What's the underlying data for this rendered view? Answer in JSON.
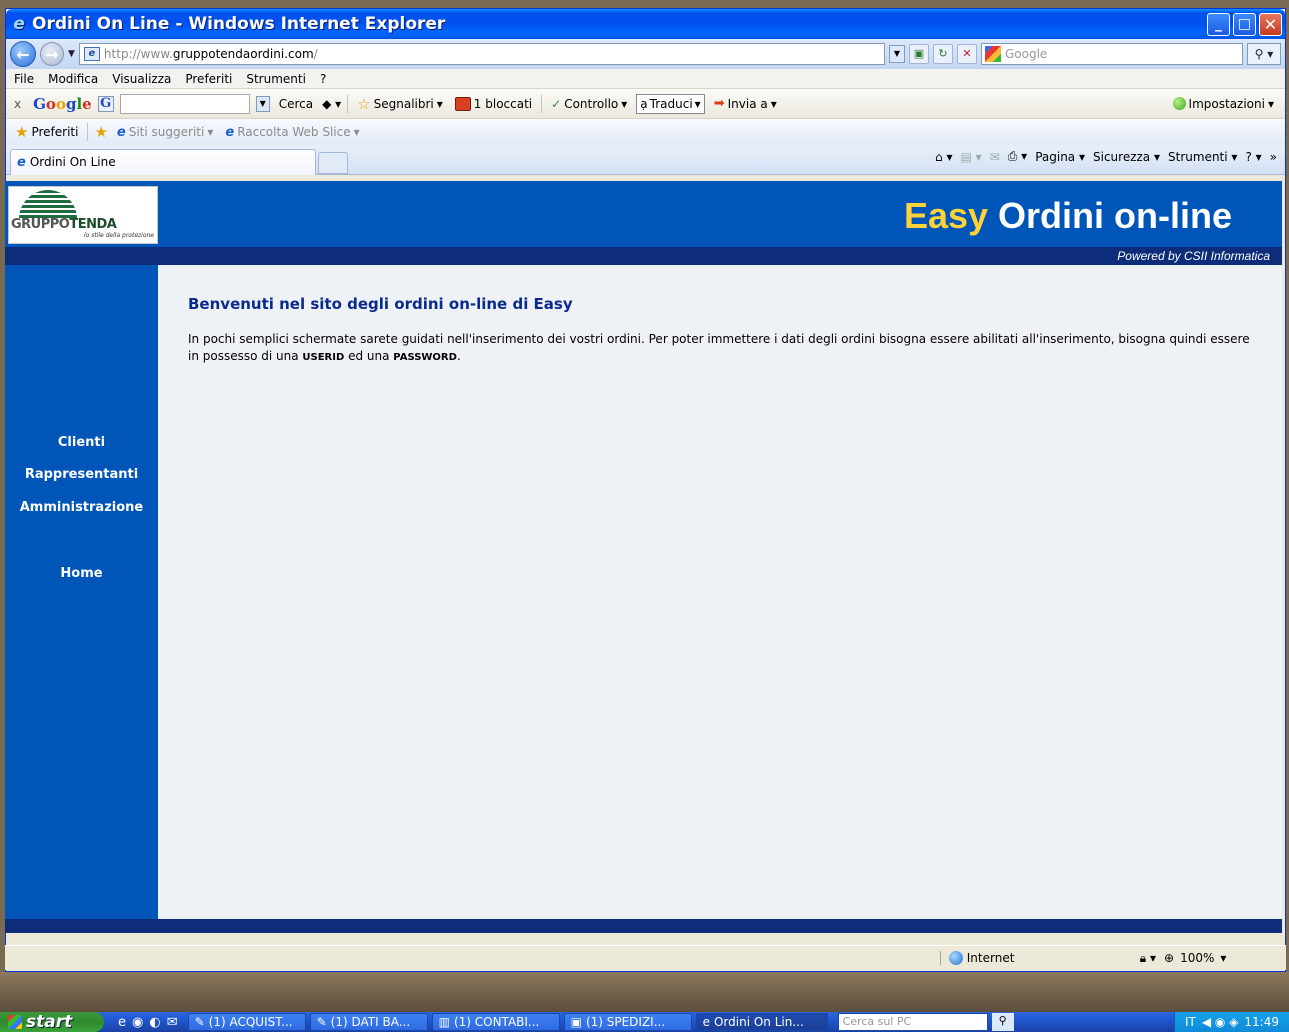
{
  "window": {
    "title": "Ordini On Line - Windows Internet Explorer",
    "buttons": {
      "minimize": "_",
      "maximize": "□",
      "close": "✕"
    }
  },
  "address_bar": {
    "url_prefix": "http://www.",
    "url_domain": "gruppotendaordini.com",
    "url_suffix": "/",
    "search_placeholder": "Google"
  },
  "menu": [
    "File",
    "Modifica",
    "Visualizza",
    "Preferiti",
    "Strumenti",
    "?"
  ],
  "google_toolbar": {
    "close": "x",
    "logo": [
      "G",
      "o",
      "o",
      "g",
      "l",
      "e"
    ],
    "search_label": "Cerca",
    "bookmarks": "Segnalibri",
    "blocked": "1 bloccati",
    "spellcheck": "Controllo",
    "translate": "Traduci",
    "send": "Invia a",
    "settings": "Impostazioni"
  },
  "favorites_bar": {
    "favorites": "Preferiti",
    "suggested": "Siti suggeriti",
    "webslice": "Raccolta Web Slice"
  },
  "tab": {
    "label": "Ordini On Line"
  },
  "command_bar": {
    "page": "Pagina",
    "security": "Sicurezza",
    "tools": "Strumenti"
  },
  "page": {
    "logo_prefix": "GRUPPO",
    "logo_bold": "TENDA",
    "logo_slogan": "lo stile della protezione",
    "banner_easy": "Easy",
    "banner_rest": " Ordini on-line",
    "powered": "Powered by CSII Informatica",
    "nav": [
      "Clienti",
      "Rappresentanti",
      "Amministrazione",
      "Home"
    ],
    "heading": "Benvenuti nel sito degli ordini on-line di Easy",
    "intro_1": "In pochi semplici schermate sarete guidati nell'inserimento dei vostri ordini. Per poter immettere i dati degli ordini bisogna essere abilitati all'inserimento, bisogna quindi essere in possesso di una ",
    "userid": "USERID",
    "intro_2": " ed una ",
    "password": "PASSWORD",
    "intro_3": "."
  },
  "status_bar": {
    "zone": "Internet",
    "zoom": "100%"
  },
  "taskbar": {
    "start": "start",
    "items": [
      "(1) ACQUIST...",
      "(1) DATI BA...",
      "(1) CONTABI...",
      "(1) SPEDIZI...",
      "Ordini On Lin..."
    ],
    "desktop_search": "Cerca sul PC",
    "lang": "IT",
    "clock": "11:49"
  }
}
